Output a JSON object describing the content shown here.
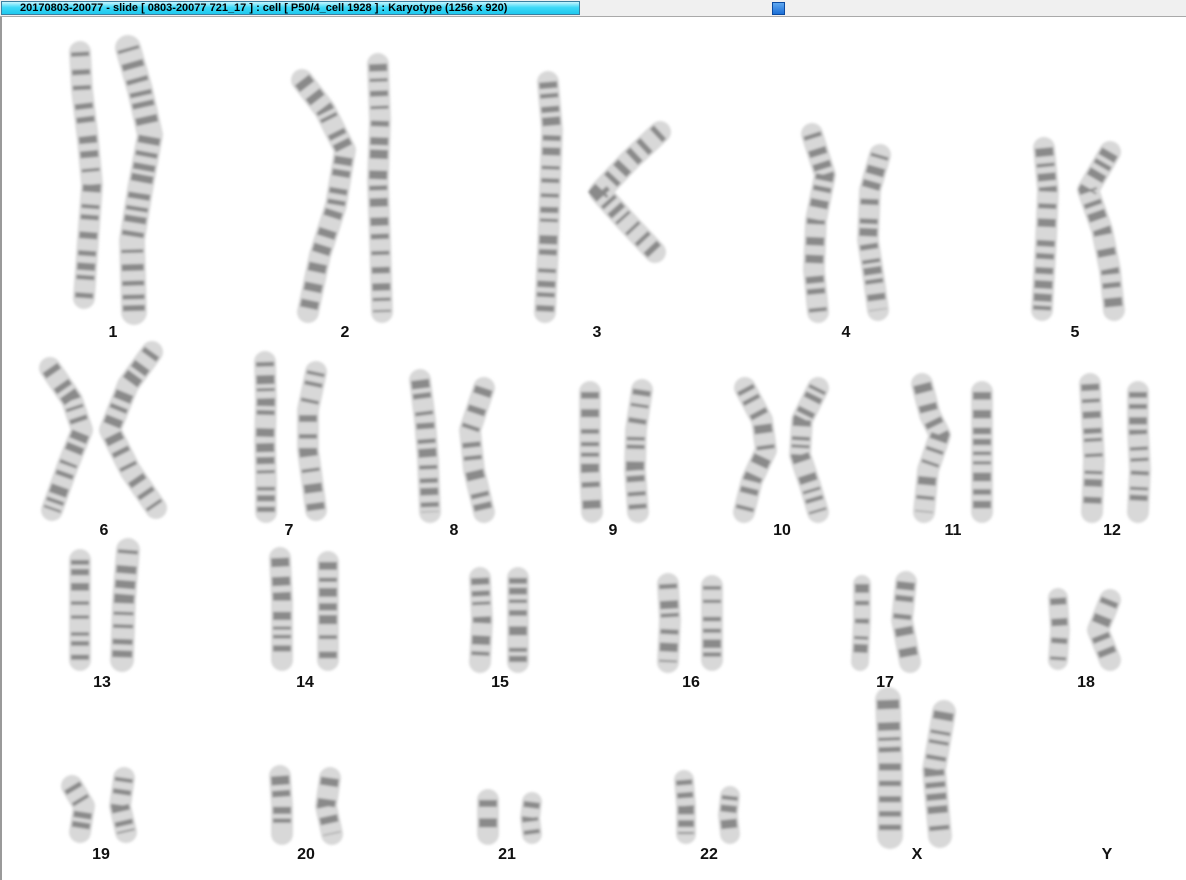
{
  "window": {
    "title": "20170803-20077 - slide [ 0803-20077 721_17 ] : cell [ P50/4_cell 1928 ] : Karyotype  (1256 x 920)"
  },
  "colors": {
    "title_tab": "#1fc8ee",
    "background": "#ffffff",
    "chromosome_light": "#d8d8d8",
    "chromosome_band": "#4a4a4a"
  },
  "karyotype": {
    "labels": [
      "1",
      "2",
      "3",
      "4",
      "5",
      "6",
      "7",
      "8",
      "9",
      "10",
      "11",
      "12",
      "13",
      "14",
      "15",
      "16",
      "17",
      "18",
      "19",
      "20",
      "21",
      "22",
      "X",
      "Y"
    ]
  }
}
